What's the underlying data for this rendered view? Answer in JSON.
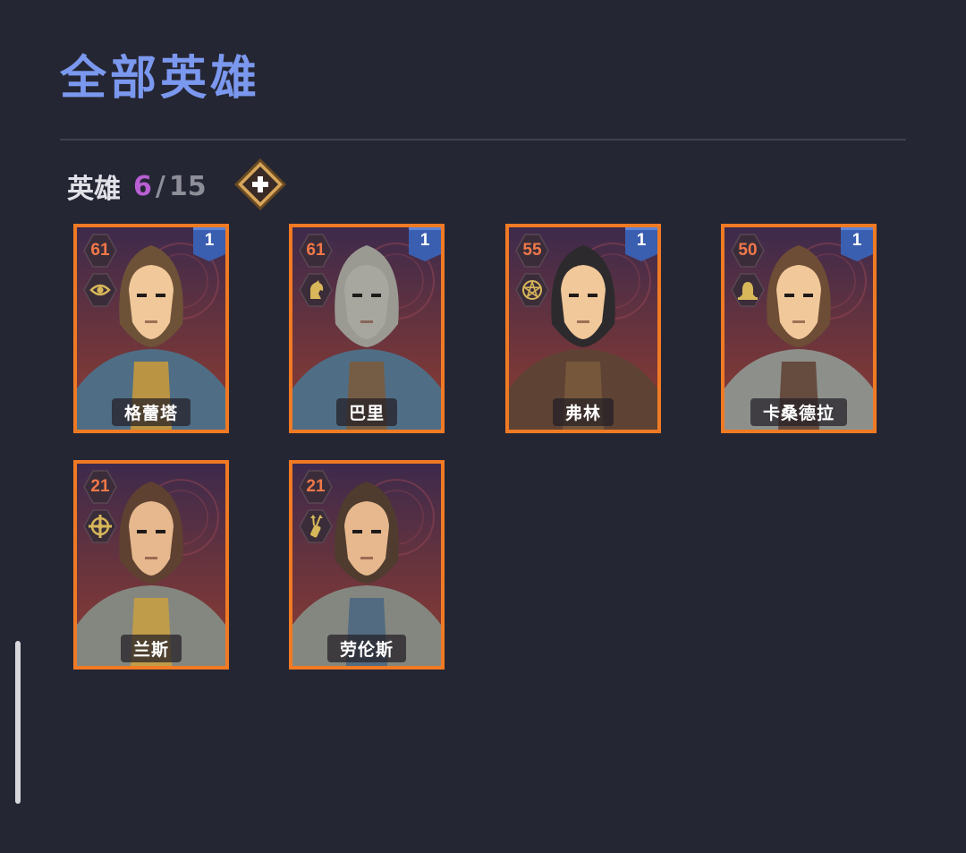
{
  "page": {
    "title": "全部英雄"
  },
  "roster": {
    "label": "英雄",
    "count": "6",
    "separator": "/",
    "max": "15",
    "add_icon": "plus-diamond-icon"
  },
  "heroes": [
    {
      "name": "格蕾塔",
      "power": "61",
      "level": "1",
      "class_icon": "eye-icon",
      "colors": {
        "bg_top": "#3d2a4c",
        "bg_bottom": "#913d30",
        "hair": "#6e5238",
        "skin": "#f1c89a",
        "clothes": "#4f6e86",
        "accent": "#cc9b37"
      }
    },
    {
      "name": "巴里",
      "power": "61",
      "level": "1",
      "class_icon": "horse-icon",
      "colors": {
        "bg_top": "#3d2a4c",
        "bg_bottom": "#913d30",
        "hair": "#9a9a92",
        "skin": "#a7a7a0",
        "clothes": "#4f6e86",
        "accent": "#7b5a39"
      }
    },
    {
      "name": "弗林",
      "power": "55",
      "level": "1",
      "class_icon": "pentagram-icon",
      "colors": {
        "bg_top": "#3d2a4c",
        "bg_bottom": "#913d30",
        "hair": "#2c2a2d",
        "skin": "#f1c89a",
        "clothes": "#5e4334",
        "accent": "#7a5a3d"
      }
    },
    {
      "name": "卡桑德拉",
      "power": "50",
      "level": "1",
      "class_icon": "bell-icon",
      "colors": {
        "bg_top": "#3d2a4c",
        "bg_bottom": "#913d30",
        "hair": "#6d4d35",
        "skin": "#f1c89a",
        "clothes": "#8d8f8b",
        "accent": "#5e4131"
      }
    },
    {
      "name": "兰斯",
      "power": "21",
      "level": "",
      "class_icon": "crosshair-icon",
      "colors": {
        "bg_top": "#3d2a4c",
        "bg_bottom": "#913d30",
        "hair": "#5f4131",
        "skin": "#e7b88e",
        "clothes": "#84877f",
        "accent": "#c9a040"
      }
    },
    {
      "name": "劳伦斯",
      "power": "21",
      "level": "",
      "class_icon": "quiver-icon",
      "colors": {
        "bg_top": "#3d2a4c",
        "bg_bottom": "#913d30",
        "hair": "#4f3c2e",
        "skin": "#e7b88e",
        "clothes": "#84877f",
        "accent": "#496680"
      }
    }
  ],
  "colors": {
    "background": "#252634",
    "title": "#7b98ef",
    "card_border": "#f07a24",
    "count_highlight": "#b95fd3",
    "power_text": "#f0784a",
    "level_badge": "#3b5fb0",
    "class_icon": "#d7b75a"
  }
}
